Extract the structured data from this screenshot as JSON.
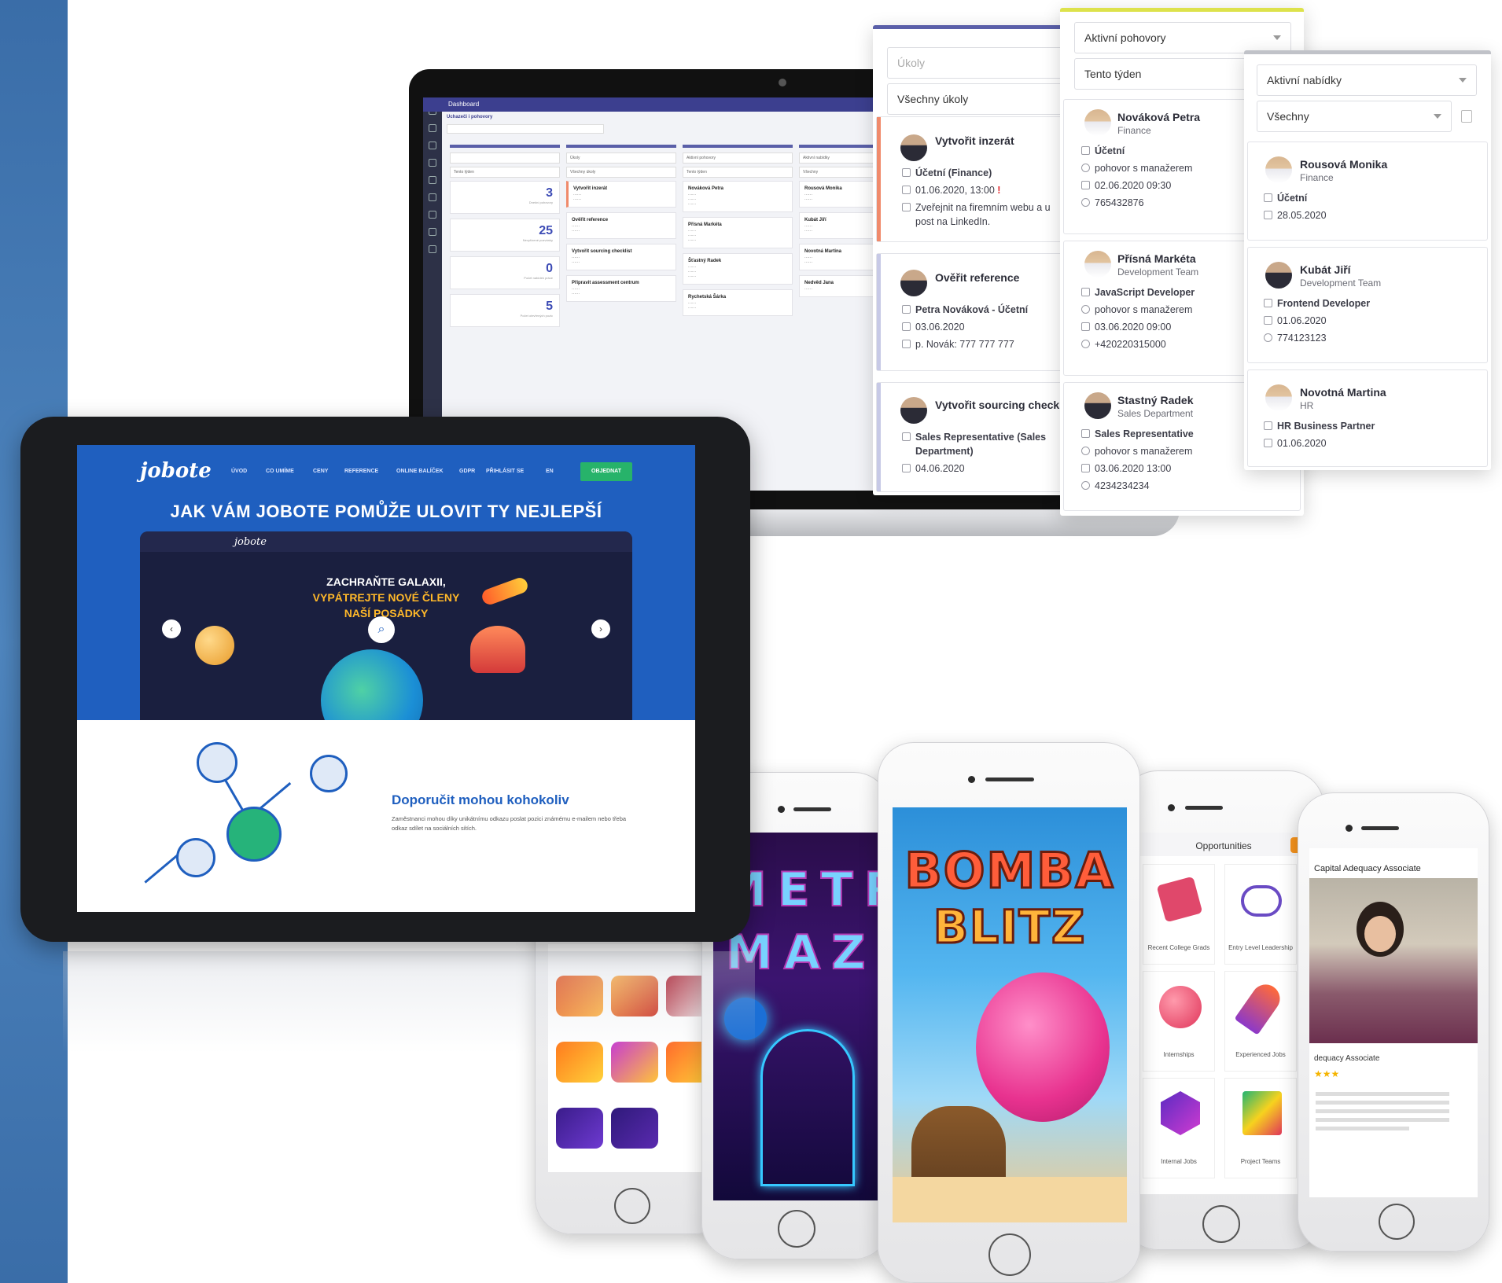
{
  "laptop": {
    "app_title": "Dashboard",
    "sub_heading": "Uchazeči i pohovory",
    "stats": [
      {
        "value": "3",
        "label": "Dnešní pohovory"
      },
      {
        "value": "25",
        "label": "Nevyřízené pozvánky"
      },
      {
        "value": "0",
        "label": "Počet nabídek práce"
      },
      {
        "value": "5",
        "label": "Počet otevřených pozic"
      }
    ],
    "col1_select1": "Tento týden",
    "col2_select1": "Úkoly",
    "col2_select2": "Všechny úkoly",
    "col3_select1": "Aktivní pohovory",
    "col3_select2": "Tento týden",
    "col4_select1": "Aktivní nabídky",
    "col4_select2": "Všechny",
    "col2_cards": [
      "Vytvořit inzerát",
      "Ověřit reference",
      "Vytvořit sourcing checklist",
      "Připravit assessment centrum"
    ],
    "col3_cards": [
      "Nováková Petra",
      "Přísná Markéta",
      "Šťastný Radek",
      "Rychetská Šárka"
    ],
    "col4_cards": [
      "Rousová Monika",
      "Kubát Jiří",
      "Novotná Martina",
      "Nedvěd Jana"
    ]
  },
  "tasks_panel": {
    "filter_placeholder": "Úkoly",
    "filter_value": "Všechny úkoly",
    "cards": [
      {
        "title": "Vytvořit inzerát",
        "line1": "Účetní (Finance)",
        "line2": "01.06.2020, 13:00",
        "alert": "!",
        "line3": "Zveřejnit na firemním webu a u",
        "line4": "post na LinkedIn."
      },
      {
        "title": "Ověřit reference",
        "line1": "Petra Nováková - Účetní",
        "line2": "03.06.2020",
        "line3": "p. Novák: 777 777 777"
      },
      {
        "title": "Vytvořit sourcing check",
        "line1": "Sales Representative (Sales",
        "line1b": "Department)",
        "line2": "04.06.2020"
      }
    ]
  },
  "interviews_panel": {
    "filter1": "Aktivní pohovory",
    "filter2": "Tento týden",
    "cards": [
      {
        "name": "Nováková Petra",
        "dept": "Finance",
        "position": "Účetní",
        "type": "pohovor s manažerem",
        "date": "02.06.2020 09:30",
        "phone": "765432876"
      },
      {
        "name": "Přísná Markéta",
        "dept": "Development Team",
        "position": "JavaScript Developer",
        "type": "pohovor s manažerem",
        "date": "03.06.2020 09:00",
        "phone": "+420220315000"
      },
      {
        "name": "Stastný Radek",
        "dept": "Sales Department",
        "position": "Sales Representative",
        "type": "pohovor s manažerem",
        "date": "03.06.2020 13:00",
        "phone": "4234234234"
      }
    ]
  },
  "offers_panel": {
    "filter1": "Aktivní nabídky",
    "filter2": "Všechny",
    "cards": [
      {
        "name": "Rousová Monika",
        "dept": "Finance",
        "position": "Účetní",
        "date": "28.05.2020"
      },
      {
        "name": "Kubát Jiří",
        "dept": "Development Team",
        "position": "Frontend Developer",
        "date": "01.06.2020",
        "phone": "774123123"
      },
      {
        "name": "Novotná Martina",
        "dept": "HR",
        "position": "HR Business Partner",
        "date": "01.06.2020"
      }
    ]
  },
  "tablet": {
    "logo": "jobote",
    "nav": [
      "ÚVOD",
      "CO UMÍME",
      "CENY",
      "REFERENCE",
      "ONLINE BALÍČEK",
      "GDPR",
      "PŘIHLÁSIT SE",
      "EN"
    ],
    "cta": "OBJEDNAT",
    "heading": "JAK VÁM JOBOTE POMŮŽE ULOVIT TY NEJLEPŠÍ",
    "inner_logo": "jobote",
    "space_line1": "ZACHRAŇTE GALAXII,",
    "space_line2": "VYPÁTREJTE NOVÉ ČLENY",
    "space_line3": "NAŠÍ POSÁDKY",
    "section_title": "Doporučit mohou kohokoliv",
    "section_text": "Zaměstnanci mohou díky unikátnímu odkazu poslat pozici známému e-mailem nebo třeba odkaz sdílet na sociálních sítích."
  },
  "phones": {
    "game1_title_line1": "BOMBA",
    "game1_title_line2": "BLITZ",
    "game2_title_line1": "METR",
    "game2_title_line2": "MAZI",
    "opportunities": {
      "title": "Opportunities",
      "tiles": [
        "Recent College Grads",
        "Entry Level Leadership",
        "Internships",
        "Experienced Jobs",
        "Internal Jobs",
        "Project Teams"
      ]
    },
    "job": {
      "title": "Capital Adequacy Associate",
      "subtitle": "dequacy Associate"
    }
  },
  "colors": {
    "side_strip": "#3a6da8",
    "accent_blue": "#3c4bb5",
    "task_accent": "#f08a6b",
    "tablet_hero": "#1f5fbf",
    "cta_green": "#27b36a",
    "alert_red": "#e3262d"
  }
}
